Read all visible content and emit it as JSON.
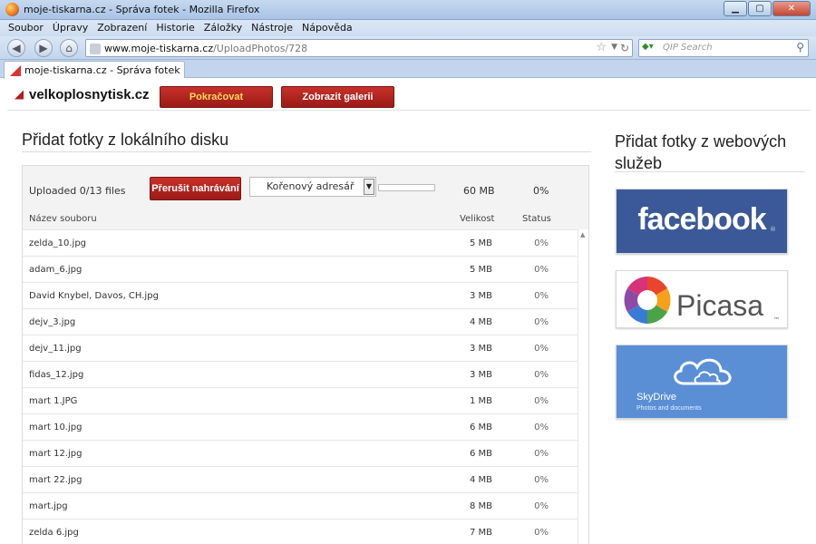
{
  "window": {
    "title": "moje-tiskarna.cz - Správa fotek - Mozilla Firefox",
    "buttons": {
      "minimize": "▁",
      "maximize": "▢",
      "close": "✕"
    }
  },
  "menu": [
    "Soubor",
    "Úpravy",
    "Zobrazení",
    "Historie",
    "Záložky",
    "Nástroje",
    "Nápověda"
  ],
  "navigation": {
    "url_host": "www.moje-tiskarna.cz",
    "url_path": "/UploadPhotos/728",
    "search_placeholder": "QIP Search"
  },
  "tab": {
    "label": "moje-tiskarna.cz - Správa fotek"
  },
  "site": {
    "logo": "velkoplosnytisk.cz",
    "continue_button": "Pokračovat",
    "gallery_button": "Zobrazit galerii"
  },
  "upload": {
    "title": "Přidat fotky z lokálního disku",
    "status": "Uploaded 0/13 files",
    "stop_button": "Přerušit nahrávání",
    "directory": "Kořenový adresář",
    "progress": 0,
    "total_size": "60 MB",
    "total_percent": "0%",
    "columns": {
      "name": "Název souboru",
      "size": "Velikost",
      "status": "Status"
    },
    "files": [
      {
        "name": "zelda_10.jpg",
        "size": "5 MB",
        "status": "0%"
      },
      {
        "name": "adam_6.jpg",
        "size": "5 MB",
        "status": "0%"
      },
      {
        "name": "David Knybel, Davos, CH.jpg",
        "size": "3 MB",
        "status": "0%"
      },
      {
        "name": "dejv_3.jpg",
        "size": "4 MB",
        "status": "0%"
      },
      {
        "name": "dejv_11.jpg",
        "size": "3 MB",
        "status": "0%"
      },
      {
        "name": "fidas_12.jpg",
        "size": "3 MB",
        "status": "0%"
      },
      {
        "name": "mart 1.JPG",
        "size": "1 MB",
        "status": "0%"
      },
      {
        "name": "mart 10.jpg",
        "size": "6 MB",
        "status": "0%"
      },
      {
        "name": "mart 12.jpg",
        "size": "6 MB",
        "status": "0%"
      },
      {
        "name": "mart 22.jpg",
        "size": "4 MB",
        "status": "0%"
      },
      {
        "name": "mart.jpg",
        "size": "8 MB",
        "status": "0%"
      },
      {
        "name": "zelda 6.jpg",
        "size": "7 MB",
        "status": "0%"
      }
    ]
  },
  "web_services": {
    "title": "Přidat fotky z webových služeb",
    "facebook": {
      "logo_text": "facebook",
      "mark": "®",
      "color": "#3b5998"
    },
    "picasa": {
      "logo_text": "Picasa",
      "mark": "™"
    },
    "skydrive": {
      "logo_text": "SkyDrive",
      "subtitle": "Photos and documents",
      "color": "#5a8fd6"
    }
  },
  "colors": {
    "accent": "#b31b1b",
    "button_text_highlight": "#ffd95c"
  }
}
